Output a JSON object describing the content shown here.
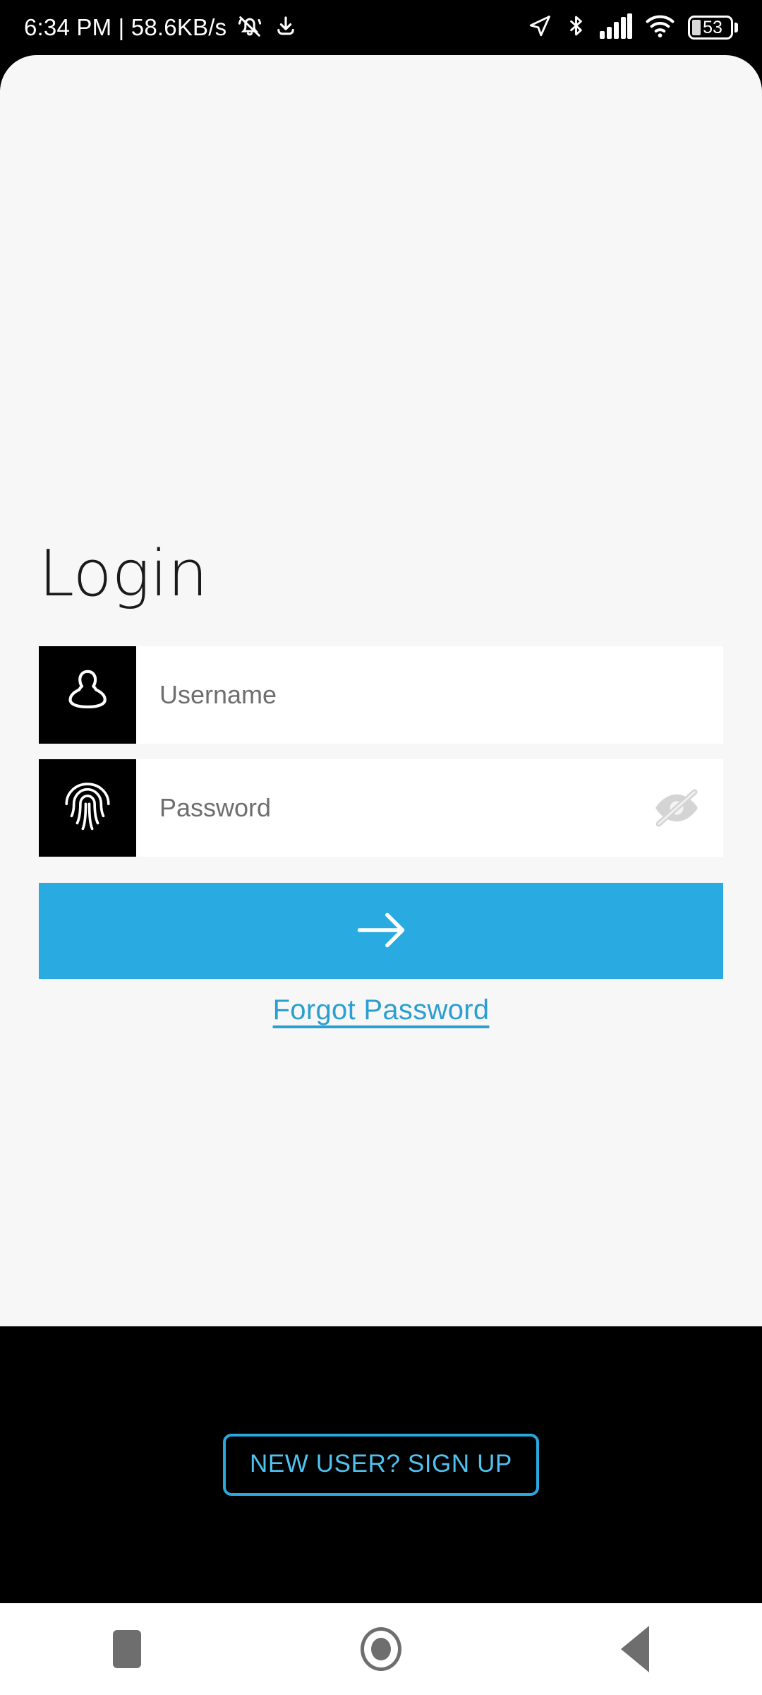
{
  "status_bar": {
    "clock_and_network": "6:34 PM | 58.6KB/s",
    "icons_left": [
      "bell-mute-icon",
      "download-icon"
    ],
    "icons_right": [
      "location-arrow-icon",
      "bluetooth-icon",
      "cellular-signal-icon",
      "wifi-icon",
      "battery-icon"
    ],
    "battery_percent": "53"
  },
  "screen": {
    "title": "Login",
    "background_color": "#f7f7f7",
    "accent_color": "#29abe2"
  },
  "form": {
    "username": {
      "placeholder": "Username",
      "value": "",
      "icon": "user-person-icon"
    },
    "password": {
      "placeholder": "Password",
      "value": "",
      "icon": "fingerprint-icon",
      "visibility_toggle_icon": "eye-slash-icon"
    },
    "submit": {
      "icon": "arrow-right-icon",
      "label": ""
    },
    "forgot_password_label": "Forgot Password"
  },
  "footer": {
    "signup_label": "NEW USER? SIGN UP",
    "background_color": "#000000",
    "border_color": "#2aa8e0"
  },
  "nav_bar": {
    "recents_label": "recents-square-icon",
    "home_label": "home-circle-icon",
    "back_label": "back-triangle-icon"
  }
}
